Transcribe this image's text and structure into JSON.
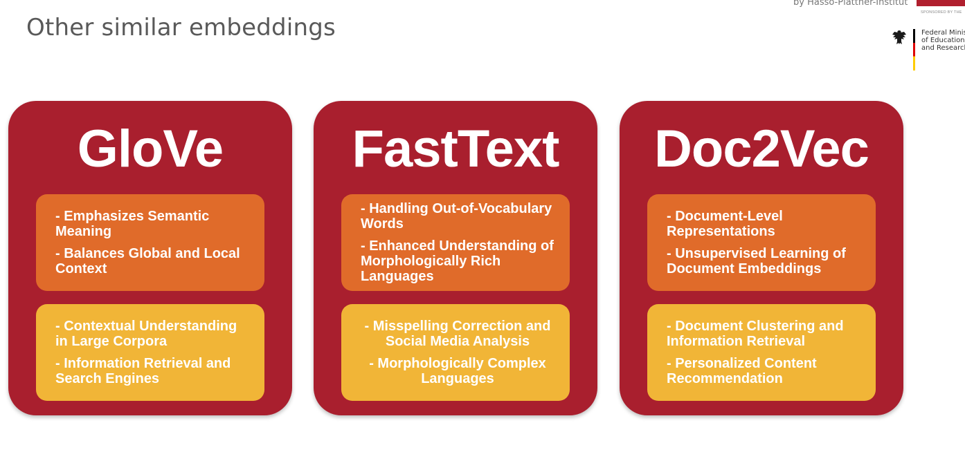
{
  "header": {
    "title": "Other similar embeddings",
    "byline": "by Hasso-Plattner-Institut",
    "sponsored_label": "SPONSORED BY THE",
    "ministry_lines": [
      "Federal Minis",
      "of Education",
      "and Research"
    ]
  },
  "colors": {
    "card": "#a91f2e",
    "primary_box": "#e06b2a",
    "secondary_box": "#f1b537",
    "flag": [
      "#000000",
      "#dd0000",
      "#ffcc00"
    ]
  },
  "cards": [
    {
      "title": "GloVe",
      "strengths": [
        "- Emphasizes Semantic Meaning",
        "- Balances Global and Local Context"
      ],
      "uses": [
        "- Contextual Understanding in Large Corpora",
        "- Information Retrieval and Search Engines"
      ]
    },
    {
      "title": "FastText",
      "strengths": [
        "- Handling Out-of-Vocabulary Words",
        "- Enhanced Understanding of Morphologically Rich Languages"
      ],
      "uses": [
        "- Misspelling Correction and Social Media Analysis",
        "- Morphologically Complex Languages"
      ]
    },
    {
      "title": "Doc2Vec",
      "strengths": [
        "- Document-Level Representations",
        "- Unsupervised Learning of Document Embeddings"
      ],
      "uses": [
        "- Document Clustering and Information Retrieval",
        "- Personalized Content Recommendation"
      ]
    }
  ]
}
